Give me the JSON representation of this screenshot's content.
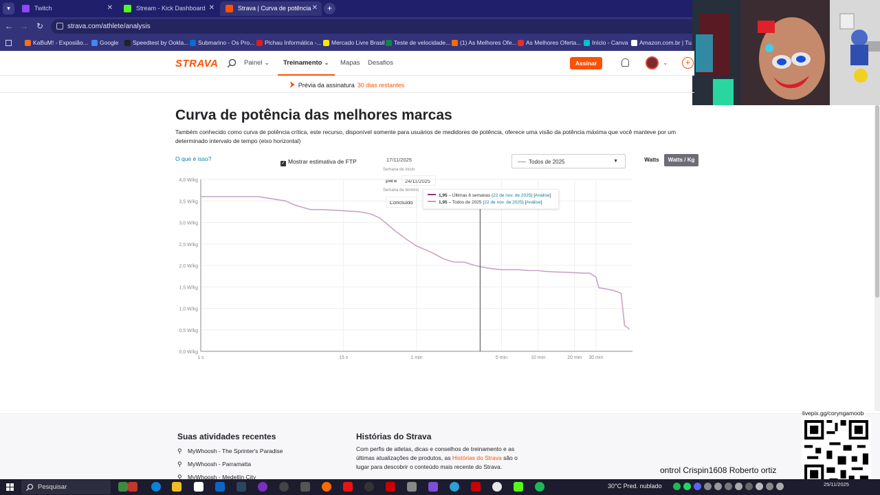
{
  "browser": {
    "tabs": [
      {
        "label": "Twitch",
        "color": "#9146ff",
        "active": false
      },
      {
        "label": "Stream - Kick Dashboard",
        "color": "#53fc18",
        "active": false
      },
      {
        "label": "Strava | Curva de potência",
        "color": "#fc5200",
        "active": true
      }
    ],
    "url": "strava.com/athlete/analysis",
    "bookmarks": [
      {
        "label": "KaBuM! - Exposião...",
        "color": "#f37021"
      },
      {
        "label": "Google",
        "color": "#4285f4"
      },
      {
        "label": "Speedtest by Ookla...",
        "color": "#222"
      },
      {
        "label": "Submarino - Os Pro...",
        "color": "#0a6ad6"
      },
      {
        "label": "Pichau Informática -...",
        "color": "#e01b22"
      },
      {
        "label": "Mercado Livre Brasil",
        "color": "#ffe600"
      },
      {
        "label": "Teste de velocidade...",
        "color": "#0b8a3f"
      },
      {
        "label": "(1) As Melhores Ofe...",
        "color": "#ff6a00"
      },
      {
        "label": "As Melhores Oferta...",
        "color": "#e52e2e"
      },
      {
        "label": "Início - Canva",
        "color": "#00c4cc"
      },
      {
        "label": "Amazon.com.br | Tu...",
        "color": "#fff"
      }
    ]
  },
  "header": {
    "logo": "STRAVA",
    "nav": [
      "Painel",
      "Treinamento",
      "Mapas",
      "Desafios"
    ],
    "subscribe": "Assinar"
  },
  "banner": {
    "text": "Prévia da assinatura",
    "days": "30 dias restantes"
  },
  "page": {
    "title": "Curva de potência das melhores marcas",
    "description": "Também conhecido como curva de potência crítica, este recurso, disponível somente para usuários de medidores de potência, oferece uma visão da potência máxima que você manteve por um determinado intervalo de tempo (eixo horizontal)",
    "whatis": "O que é isso?",
    "ftp_label": "Mostrar estimativa de FTP",
    "start_date": "17/11/2025",
    "start_label": "Semana de início",
    "to_label": "para",
    "end_date": "24/11/2025",
    "end_label": "Semana de término",
    "done": "Concluído",
    "period_select": "Todos de 2025",
    "unit_watts": "Watts",
    "unit_wkg": "Watts / Kg"
  },
  "tooltip": {
    "rows": [
      {
        "value": "1,95",
        "label": "Últimas 6 semanas",
        "date": "22 de nov. de 2025",
        "link": "Análise",
        "color": "#9b2c6f"
      },
      {
        "value": "1,95",
        "label": "Todos de 2025",
        "date": "22 de nov. de 2025",
        "link": "Análise",
        "color": "#b6a0b9"
      }
    ]
  },
  "chart_data": {
    "type": "line",
    "xlabel": "",
    "ylabel": "",
    "x_ticks": [
      "1 s",
      "15 s",
      "1 min",
      "5 min",
      "10 min",
      "20 min",
      "30 min"
    ],
    "x_tick_seconds": [
      1,
      15,
      60,
      300,
      600,
      1200,
      1800
    ],
    "x_range_seconds": [
      1,
      3600
    ],
    "y_ticks": [
      "4,0 W/kg",
      "3,5 W/kg",
      "3,0 W/kg",
      "2,5 W/kg",
      "2,0 W/kg",
      "1,5 W/kg",
      "1,0 W/kg",
      "0,5 W/kg",
      "0,0 W/kg"
    ],
    "ylim": [
      0,
      4.0
    ],
    "series": [
      {
        "name": "Últimas 6 semanas",
        "color": "#c9a3c4",
        "x": [
          1,
          3,
          5,
          6,
          8,
          10,
          15,
          20,
          25,
          30,
          40,
          50,
          60,
          80,
          100,
          120,
          150,
          180,
          200,
          240,
          300,
          360,
          420,
          500,
          600,
          700,
          800,
          1000,
          1200,
          1400,
          1600,
          1800,
          1900,
          2200,
          2500,
          2900,
          3100,
          3400
        ],
        "y": [
          3.6,
          3.6,
          3.5,
          3.4,
          3.3,
          3.3,
          3.27,
          3.25,
          3.2,
          3.1,
          2.8,
          2.6,
          2.45,
          2.3,
          2.15,
          2.08,
          2.07,
          2.0,
          1.97,
          1.93,
          1.9,
          1.9,
          1.9,
          1.88,
          1.88,
          1.86,
          1.85,
          1.84,
          1.83,
          1.82,
          1.82,
          1.73,
          1.48,
          1.45,
          1.42,
          1.35,
          0.6,
          0.52
        ]
      }
    ],
    "cursor_x_seconds": 200
  },
  "footer": {
    "recent_title": "Suas atividades recentes",
    "activities": [
      "MyWhoosh - The Sprinter's Paradise",
      "MyWhoosh - Parramatta",
      "MyWhoosh - Medellín City"
    ],
    "stories_title": "Histórias do Strava",
    "stories_text_1": "Com perfis de atletas, dicas e conselhos de treinamento e as últimas atualizações de produtos, as",
    "stories_link": "Histórias do Strava",
    "stories_text_2": "são o lugar para descobrir o conteúdo mais recente do Strava."
  },
  "overlay": {
    "qr_label": "livepix.gg/coryngamoob",
    "chat": "ontrol   Crispin1608   Roberto   ortiz"
  },
  "taskbar": {
    "search": "Pesquisar",
    "weather": "30°C  Pred. nublado",
    "time": "",
    "date": "25/11/2025"
  }
}
